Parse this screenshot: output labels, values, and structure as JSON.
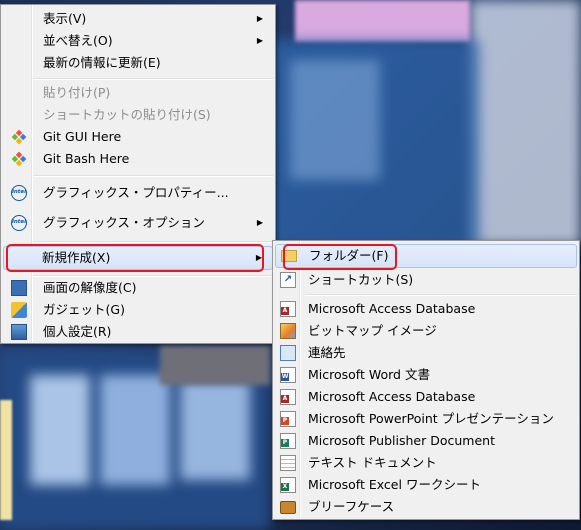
{
  "main_menu": {
    "items": [
      {
        "label": "表示(V)",
        "submenu": true
      },
      {
        "label": "並べ替え(O)",
        "submenu": true
      },
      {
        "label": "最新の情報に更新(E)"
      },
      {
        "label": "貼り付け(P)",
        "disabled": true
      },
      {
        "label": "ショートカットの貼り付け(S)",
        "disabled": true
      },
      {
        "label": "Git GUI Here",
        "icon": "git-gui-icon"
      },
      {
        "label": "Git Bash Here",
        "icon": "git-bash-icon"
      },
      {
        "label": "グラフィックス・プロパティー...",
        "icon": "intel-icon"
      },
      {
        "label": "グラフィックス・オプション",
        "icon": "intel-icon",
        "submenu": true
      },
      {
        "label": "新規作成(X)",
        "submenu": true,
        "highlighted": true
      },
      {
        "label": "画面の解像度(C)",
        "icon": "display-icon"
      },
      {
        "label": "ガジェット(G)",
        "icon": "gadget-icon"
      },
      {
        "label": "個人設定(R)",
        "icon": "personalize-icon"
      }
    ]
  },
  "new_submenu": {
    "items": [
      {
        "label": "フォルダー(F)",
        "icon": "folder-icon",
        "highlighted": true
      },
      {
        "label": "ショートカット(S)",
        "icon": "shortcut-icon"
      },
      {
        "label": "Microsoft Access Database",
        "icon": "access-icon"
      },
      {
        "label": "ビットマップ イメージ",
        "icon": "bitmap-icon"
      },
      {
        "label": "連絡先",
        "icon": "contact-icon"
      },
      {
        "label": "Microsoft Word 文書",
        "icon": "word-icon"
      },
      {
        "label": "Microsoft Access Database",
        "icon": "access-icon"
      },
      {
        "label": "Microsoft PowerPoint プレゼンテーション",
        "icon": "powerpoint-icon"
      },
      {
        "label": "Microsoft Publisher Document",
        "icon": "publisher-icon"
      },
      {
        "label": "テキスト ドキュメント",
        "icon": "text-document-icon"
      },
      {
        "label": "Microsoft Excel ワークシート",
        "icon": "excel-icon"
      },
      {
        "label": "ブリーフケース",
        "icon": "briefcase-icon"
      }
    ]
  },
  "colors": {
    "highlight_border": "#e8161f",
    "menu_bg": "#f0f0f0",
    "disabled_text": "#8d8d8d"
  }
}
